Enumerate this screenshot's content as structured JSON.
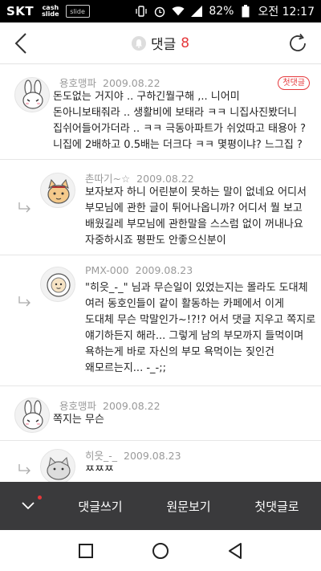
{
  "status_bar": {
    "carrier": "SKT",
    "app_badge_line1": "cash",
    "app_badge_line2": "slide",
    "notif_badge": "slide",
    "battery": "82%",
    "time": "오전 12:17"
  },
  "header": {
    "title": "댓글",
    "count": "8"
  },
  "comments": [
    {
      "author": "용호맹파",
      "date": "2009.08.22",
      "badge": "첫댓글",
      "lines": [
        "돈도없는 거지야 .. 구하긴뭘구해 ,.. 니어미",
        "돈아니보태줘라 .. 생활비에 보태라 ㅋㅋ 니집사진봤더니",
        "집쉬어들어가더라 .. ㅋㅋ 극동아파트가 쉬었따고 태용아 ?",
        "니집에 2배하고 0.5배는 더크다 ㅋㅋ 몇평이냐? 느그집 ?"
      ]
    },
    {
      "author": "촌따기~☆",
      "date": "2009.08.22",
      "lines": [
        "보자보자 하니 어린분이 못하는 말이 없네요 어디서",
        "부모님에 관한 글이 튀어나옵니까? 어디서 뭘 보고",
        "배웠길레 부모님에 관한말을 스스럼 없이 꺼내나요",
        "자중하시죠 평판도 안좋으신분이"
      ]
    },
    {
      "author": "PMX-000",
      "date": "2009.08.23",
      "lines": [
        "\"히읏_-_\" 님과 무슨일이 있었는지는 몰라도 도대체",
        "여러 동호인들이 같이 활동하는 카페에서 이게",
        "도대체 무슨 막말인가~!?!? 어서 댓글 지우고 쪽지로",
        "얘기하든지 해라... 그렇게 남의 부모까지 들먹이며",
        "욕하는게 바로 자신의 부모 욕먹이는 짖인건",
        "왜모르는지... -_-;;"
      ]
    },
    {
      "author": "용호맹파",
      "date": "2009.08.22",
      "lines": [
        "쪽지는 무슨"
      ]
    },
    {
      "author": "히읏_-_",
      "date": "2009.08.23",
      "lines": [
        "ㅉㅉㅉ"
      ]
    }
  ],
  "bottom_bar": {
    "write_label": "댓글쓰기",
    "original_label": "원문보기",
    "first_comment_label": "첫댓글로"
  },
  "colors": {
    "accent": "#e5383b",
    "bottom_bar": "#3a3a3c"
  }
}
